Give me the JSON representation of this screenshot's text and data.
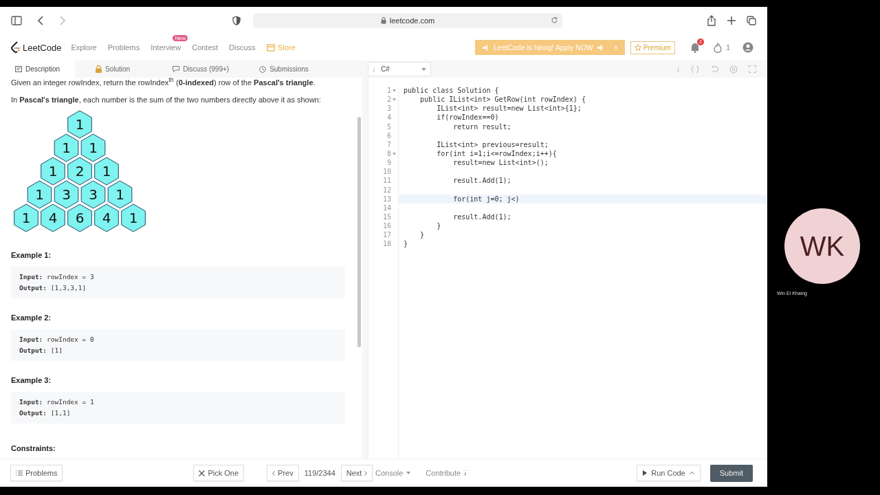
{
  "browser": {
    "url": "leetcode.com"
  },
  "nav": {
    "logo": "LeetCode",
    "items": [
      {
        "label": "Explore",
        "kind": "link"
      },
      {
        "label": "Problems",
        "kind": "link"
      },
      {
        "label": "Interview",
        "kind": "link",
        "badge": "New"
      },
      {
        "label": "Contest",
        "kind": "link"
      },
      {
        "label": "Discuss",
        "kind": "link"
      },
      {
        "label": "Store",
        "kind": "store"
      }
    ],
    "banner": "LeetCode is hiring! Apply NOW",
    "banner_close": "×",
    "premium": "Premium",
    "notifications": "2",
    "streak": "1"
  },
  "tabs": [
    {
      "label": "Description",
      "selected": true,
      "kind": "description"
    },
    {
      "label": "Solution",
      "selected": false,
      "kind": "solution"
    },
    {
      "label": "Discuss (999+)",
      "selected": false,
      "kind": "discuss"
    },
    {
      "label": "Submissions",
      "selected": false,
      "kind": "submissions"
    }
  ],
  "language": "C#",
  "description": {
    "intro": "Given an integer rowIndex, return the rowIndex$^{th}$ (**0-indexed**) row of the **Pascal's triangle**.",
    "sentence": "In **Pascal's triangle**, each number is the sum of the two numbers directly above it as shown:",
    "triangle": [
      [
        "1"
      ],
      [
        "1",
        "1"
      ],
      [
        "1",
        "2",
        "1"
      ],
      [
        "1",
        "3",
        "3",
        "1"
      ],
      [
        "1",
        "4",
        "6",
        "4",
        "1"
      ]
    ],
    "examples": [
      {
        "title": "Example 1:",
        "input": "**Input:** rowIndex = 3",
        "output": "**Output:** [1,3,3,1]"
      },
      {
        "title": "Example 2:",
        "input": "**Input:** rowIndex = 0",
        "output": "**Output:** [1]"
      },
      {
        "title": "Example 3:",
        "input": "**Input:** rowIndex = 1",
        "output": "**Output:** [1,1]"
      }
    ],
    "constraints": "Constraints:"
  },
  "editor": {
    "lines": [
      {
        "n": "1",
        "text": "public class Solution {",
        "foldable": true,
        "active": false
      },
      {
        "n": "2",
        "text": "    public IList<int> GetRow(int rowIndex) {",
        "foldable": true,
        "active": false
      },
      {
        "n": "3",
        "text": "        IList<int> result=new List<int>{1};",
        "foldable": false,
        "active": false
      },
      {
        "n": "4",
        "text": "        if(rowIndex==0)",
        "foldable": false,
        "active": false
      },
      {
        "n": "5",
        "text": "            return result;",
        "foldable": false,
        "active": false
      },
      {
        "n": "6",
        "foldable": false,
        "active": false
      },
      {
        "n": "7",
        "text": "        IList<int> previous=result;",
        "foldable": false,
        "active": false
      },
      {
        "n": "8",
        "text": "        for(int i=1;i<=rowIndex;i++){",
        "foldable": true,
        "active": false
      },
      {
        "n": "9",
        "text": "            result=new List<int>();",
        "foldable": false,
        "active": false
      },
      {
        "n": "10",
        "foldable": false,
        "active": false
      },
      {
        "n": "11",
        "text": "            result.Add(1);",
        "foldable": false,
        "active": false
      },
      {
        "n": "12",
        "foldable": false,
        "active": false
      },
      {
        "n": "13",
        "text": "            for(int j=0; j<)",
        "foldable": false,
        "active": true
      },
      {
        "n": "14",
        "foldable": false,
        "active": false
      },
      {
        "n": "15",
        "text": "            result.Add(1);",
        "foldable": false,
        "active": false
      },
      {
        "n": "16",
        "text": "        }",
        "foldable": false,
        "active": false
      },
      {
        "n": "17",
        "text": "    }",
        "foldable": false,
        "active": false
      },
      {
        "n": "18",
        "text": "}",
        "foldable": false,
        "active": false
      }
    ]
  },
  "footer": {
    "problems": "Problems",
    "pick": "Pick One",
    "prev": "Prev",
    "counter": "119/2344",
    "next": "Next",
    "console": "Console",
    "contribute": "Contribute",
    "run": "Run Code",
    "submit": "Submit"
  },
  "participant": {
    "initials": "WK",
    "name": "Win Ei Khaing"
  }
}
